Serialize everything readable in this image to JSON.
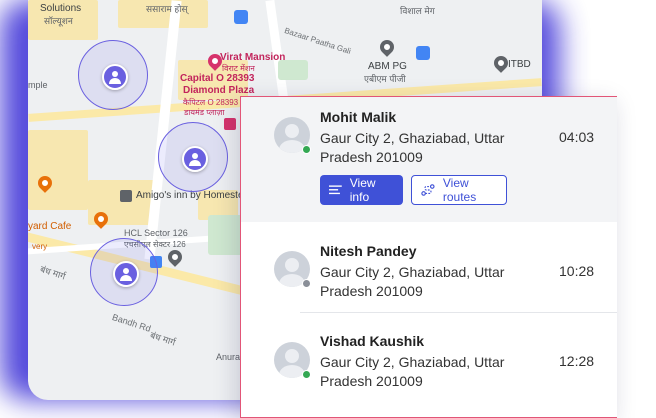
{
  "map": {
    "labels": {
      "solutions": "Solutions",
      "hindi_top": "सॉल्यूशन",
      "sasaram": "ससाराम होस्",
      "vishal": "विशाल मेग",
      "virat": "Virat Mansion",
      "virat_hi": "विराट मेंशन",
      "capital": "Capital O 28393",
      "diamond": "Diamond Plaza",
      "capital_hi": "कैपिटल O 28393",
      "diamond_hi": "डायमंड प्लाज़ा",
      "abm": "ABM PG",
      "abm_hi": "एबीएम पीजी",
      "itbd": "ITBD",
      "bazaar": "Bazaar Paatha Gali",
      "temple": "mple",
      "amigos": "Amigo's inn by Homeste",
      "yard": "yard Cafe",
      "very": "very",
      "hcl": "HCL Sector 126",
      "hcl_hi": "एचसीएल सेक्टर 126",
      "bandh_road": "Bandh Rd",
      "bandh_hi": "बंध मार्ग",
      "bandh_hi2": "बंध मार्ग",
      "anura": "Anura"
    },
    "icons": [
      "user-icon",
      "map-pin-icon",
      "food-icon",
      "bus-icon",
      "hotel-icon"
    ]
  },
  "panel": {
    "entries": [
      {
        "name": "Mohit Malik",
        "address": "Gaur City 2, Ghaziabad, Uttar Pradesh 201009",
        "time": "04:03",
        "status_color": "#34a853",
        "actions": {
          "view_info": "View info",
          "view_routes": "View routes"
        }
      },
      {
        "name": "Nitesh Pandey",
        "address": "Gaur City 2, Ghaziabad, Uttar Pradesh 201009",
        "time": "10:28",
        "status_color": "#8a8f98"
      },
      {
        "name": "Vishad Kaushik",
        "address": "Gaur City 2, Ghaziabad, Uttar Pradesh 201009",
        "time": "12:28",
        "status_color": "#34a853"
      }
    ]
  },
  "colors": {
    "accent": "#3f51d7",
    "frame": "#4338d8",
    "panel_border": "#e25577"
  }
}
